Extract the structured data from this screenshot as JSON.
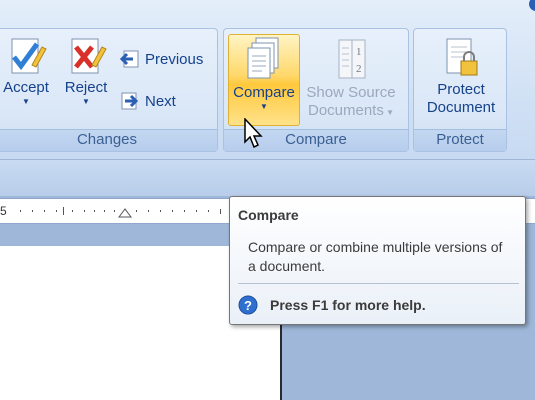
{
  "ribbon": {
    "changes": {
      "label": "Changes",
      "accept_label": "Accept",
      "reject_label": "Reject",
      "previous_label": "Previous",
      "next_label": "Next"
    },
    "compare": {
      "label": "Compare",
      "compare_label": "Compare",
      "show_source_line1": "Show Source",
      "show_source_line2": "Documents"
    },
    "protect": {
      "label": "Protect",
      "protect_line1": "Protect",
      "protect_line2": "Document"
    }
  },
  "ruler": {
    "number": "5"
  },
  "tooltip": {
    "title": "Compare",
    "description": "Compare or combine multiple versions of a document.",
    "help": "Press F1 for more help."
  },
  "colors": {
    "ribbon_text": "#15428b",
    "hot_button": "#ffd86b",
    "background": "#9fb8da"
  }
}
